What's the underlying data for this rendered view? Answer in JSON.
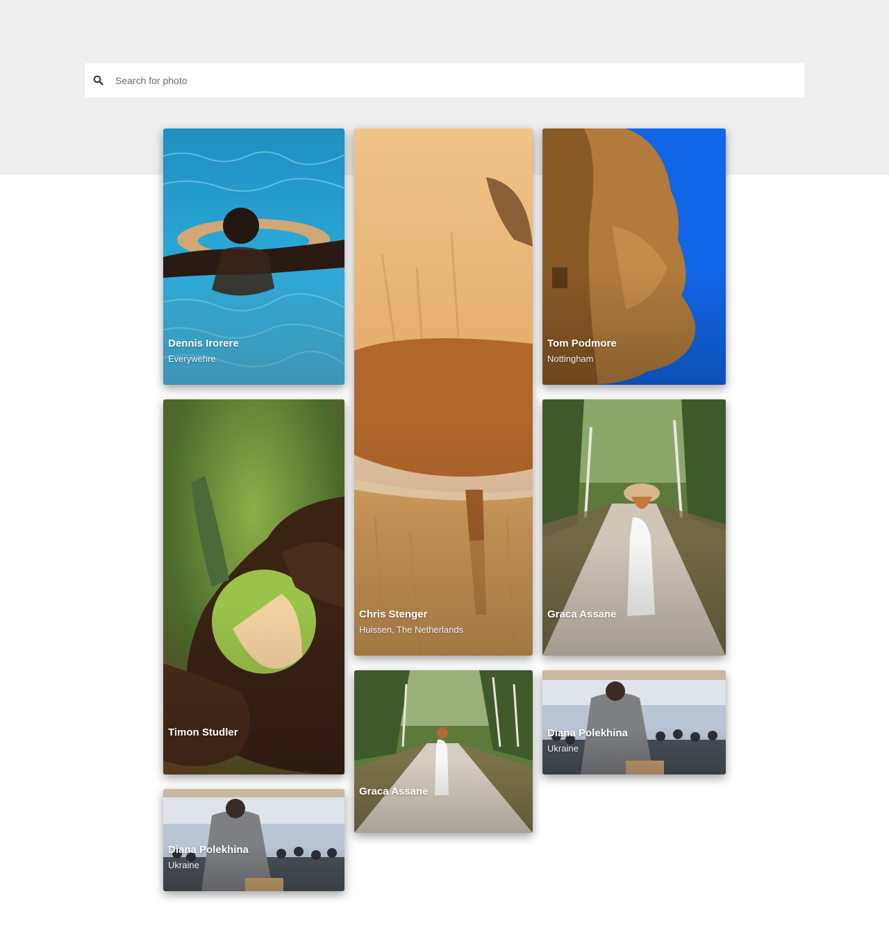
{
  "search": {
    "placeholder": "Search for photo",
    "icon": "search-icon"
  },
  "photos": [
    {
      "name": "Dennis Irorere",
      "location": "Everywehre"
    },
    {
      "name": "Chris Stenger",
      "location": "Huissen, The Netherlands"
    },
    {
      "name": "Tom Podmore",
      "location": "Nottingham"
    },
    {
      "name": "Timon Studler",
      "location": ""
    },
    {
      "name": "Graca Assane",
      "location": ""
    },
    {
      "name": "Graca Assane",
      "location": ""
    },
    {
      "name": "Diana Polekhina",
      "location": "Ukraine"
    },
    {
      "name": "Diana Polekhina",
      "location": "Ukraine"
    }
  ]
}
